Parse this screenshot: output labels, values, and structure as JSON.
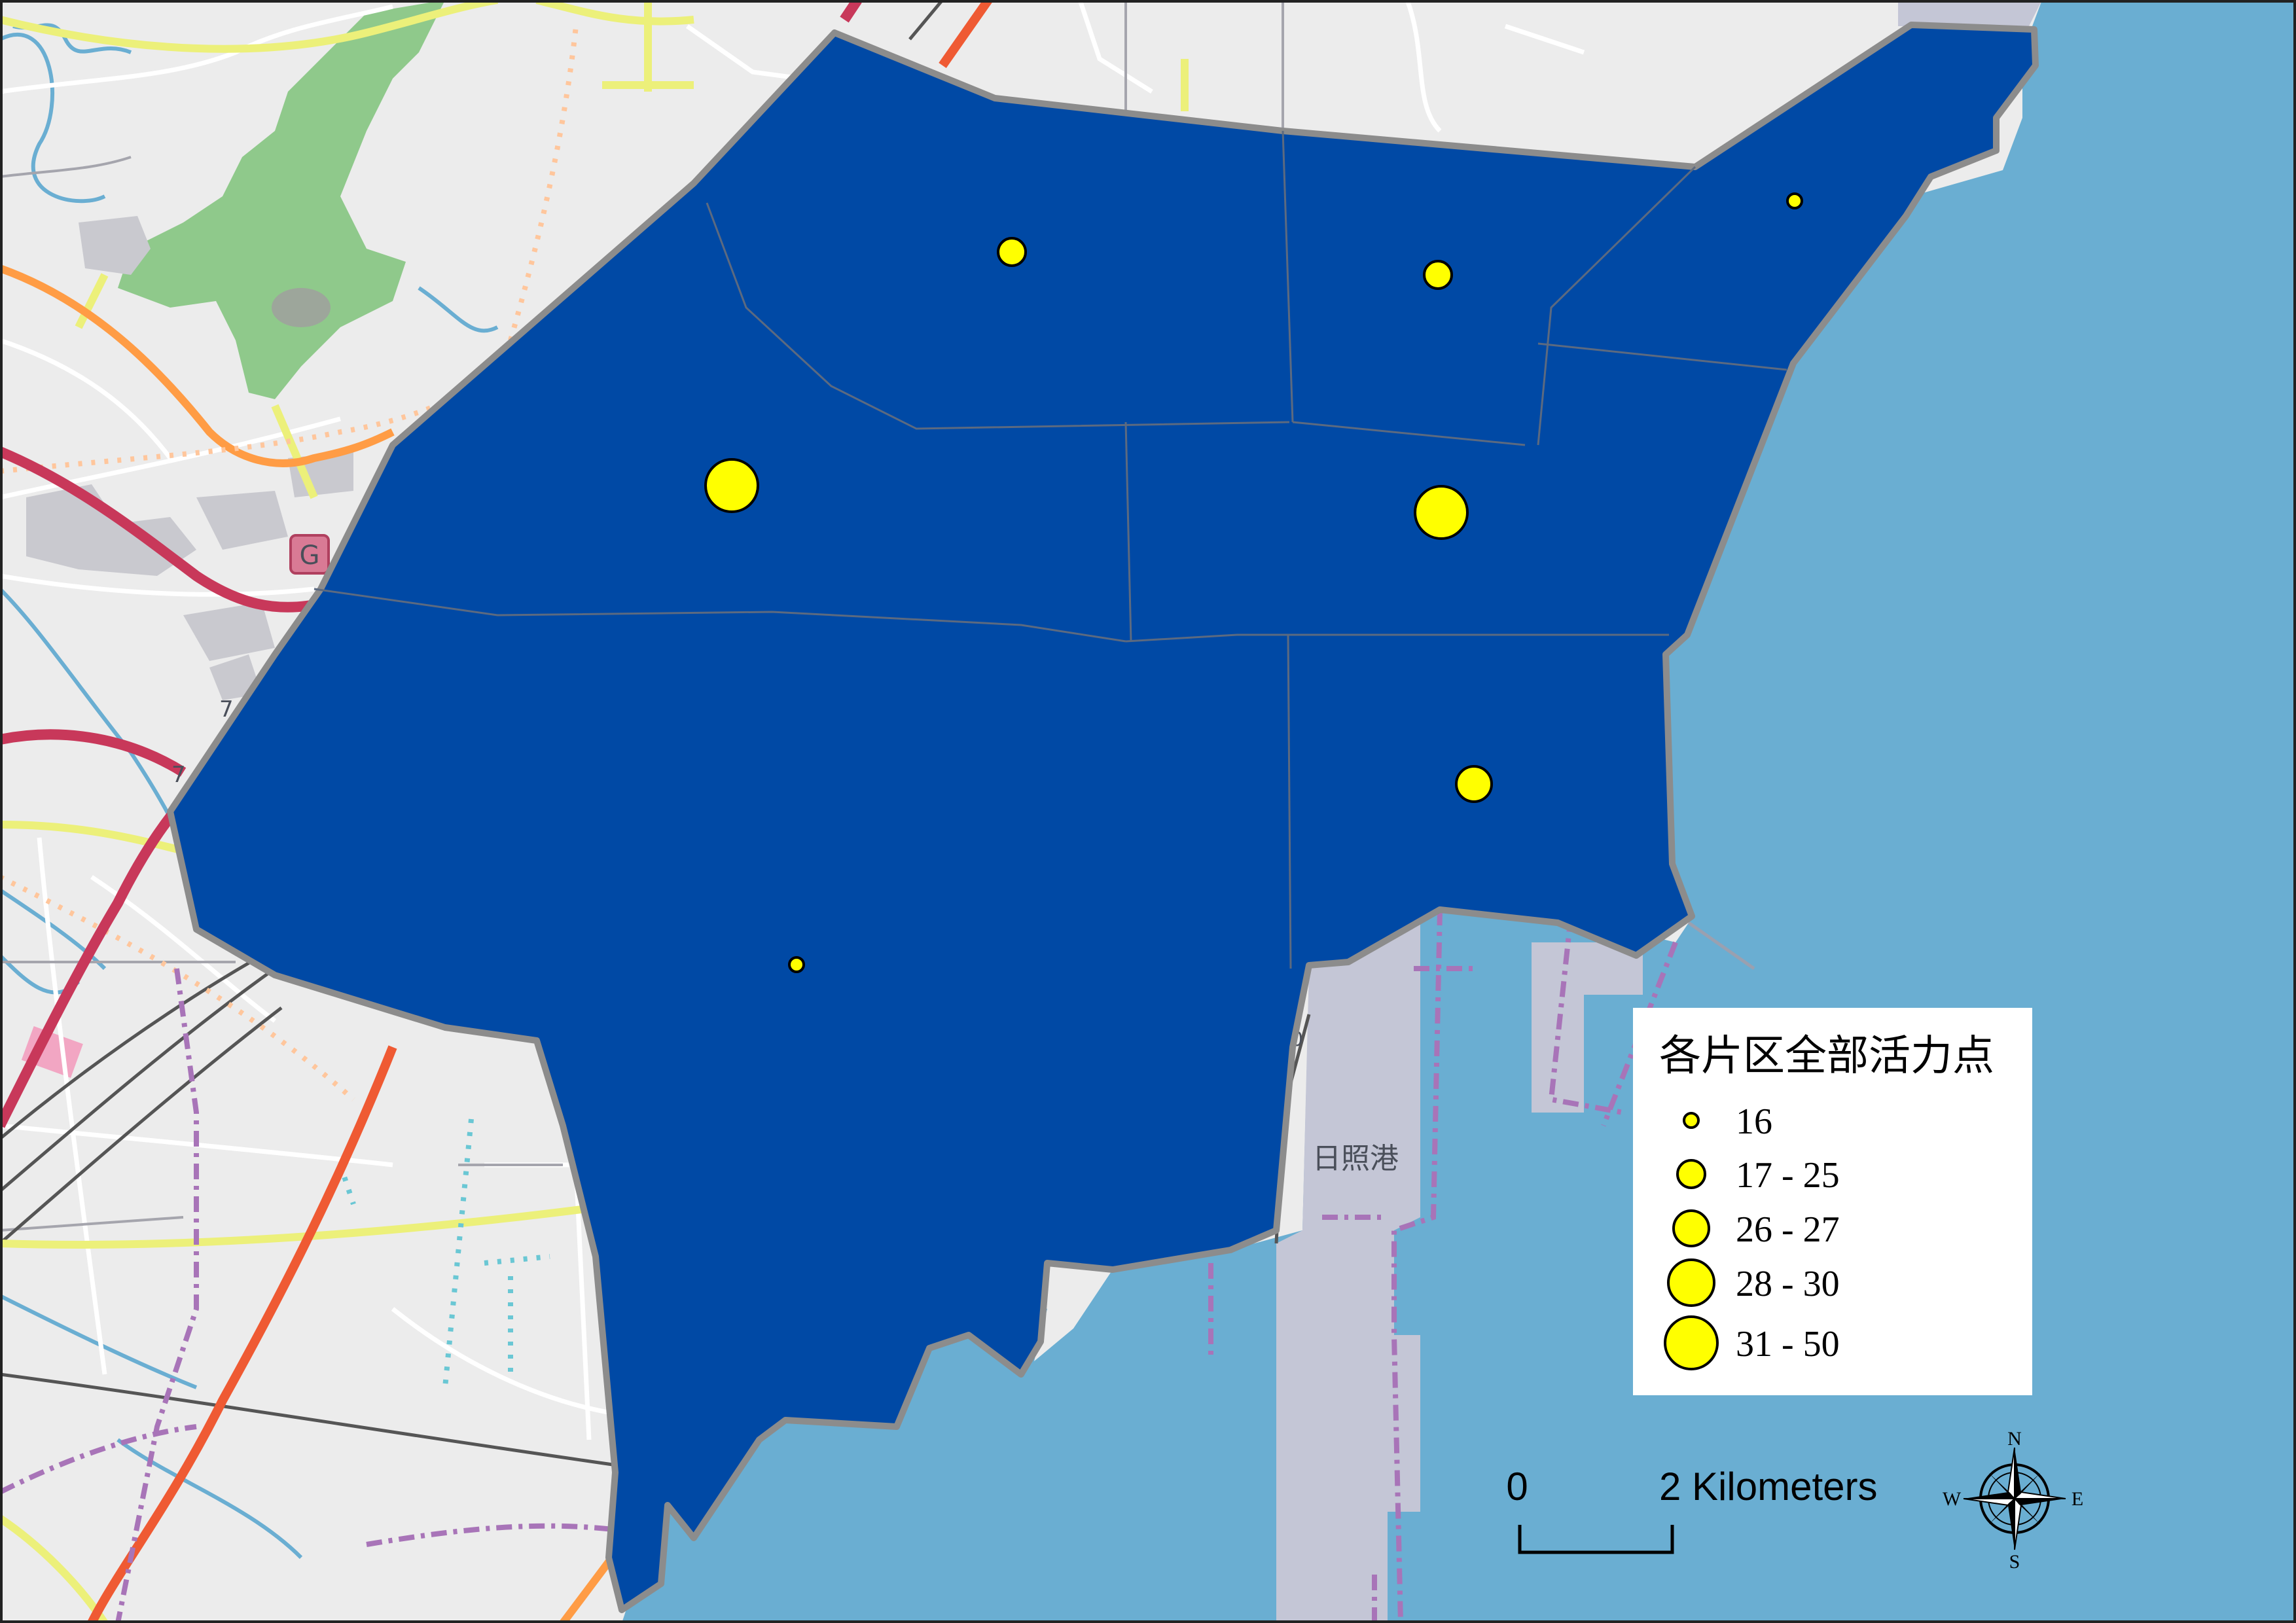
{
  "basemap": {
    "place_label": "日照港",
    "road_badge": "G",
    "road_labels": [
      "7",
      "7",
      "0"
    ]
  },
  "colors": {
    "land": "#ececec",
    "water": "#6aaed2",
    "port": "#c4c6d6",
    "district_fill": "#0049a5",
    "district_border": "#8c8c8c",
    "point_fill": "#ffff00",
    "motorway": "#c8385a",
    "primary_road": "#ef5a33",
    "secondary_road": "#ff9c45",
    "tertiary_road": "#ecf07a",
    "boundary": "#a874b8",
    "forest": "#8fc98b"
  },
  "legend": {
    "title": "各片区全部活力点",
    "classes": [
      {
        "label": "16",
        "size_rank": 1
      },
      {
        "label": "17 - 25",
        "size_rank": 2
      },
      {
        "label": "26 - 27",
        "size_rank": 3
      },
      {
        "label": "28 - 30",
        "size_rank": 4
      },
      {
        "label": "31 - 50",
        "size_rank": 5
      }
    ]
  },
  "points": [
    {
      "district": "north-center",
      "class": 2
    },
    {
      "district": "north-east-center",
      "class": 2
    },
    {
      "district": "north-east",
      "class": 1
    },
    {
      "district": "west-middle",
      "class": 5
    },
    {
      "district": "east-middle",
      "class": 5
    },
    {
      "district": "south-east",
      "class": 3
    },
    {
      "district": "south",
      "class": 1
    }
  ],
  "scale_bar": {
    "start_label": "0",
    "end_label": "2 Kilometers"
  },
  "compass": {
    "n": "N",
    "s": "S",
    "e": "E",
    "w": "W"
  }
}
